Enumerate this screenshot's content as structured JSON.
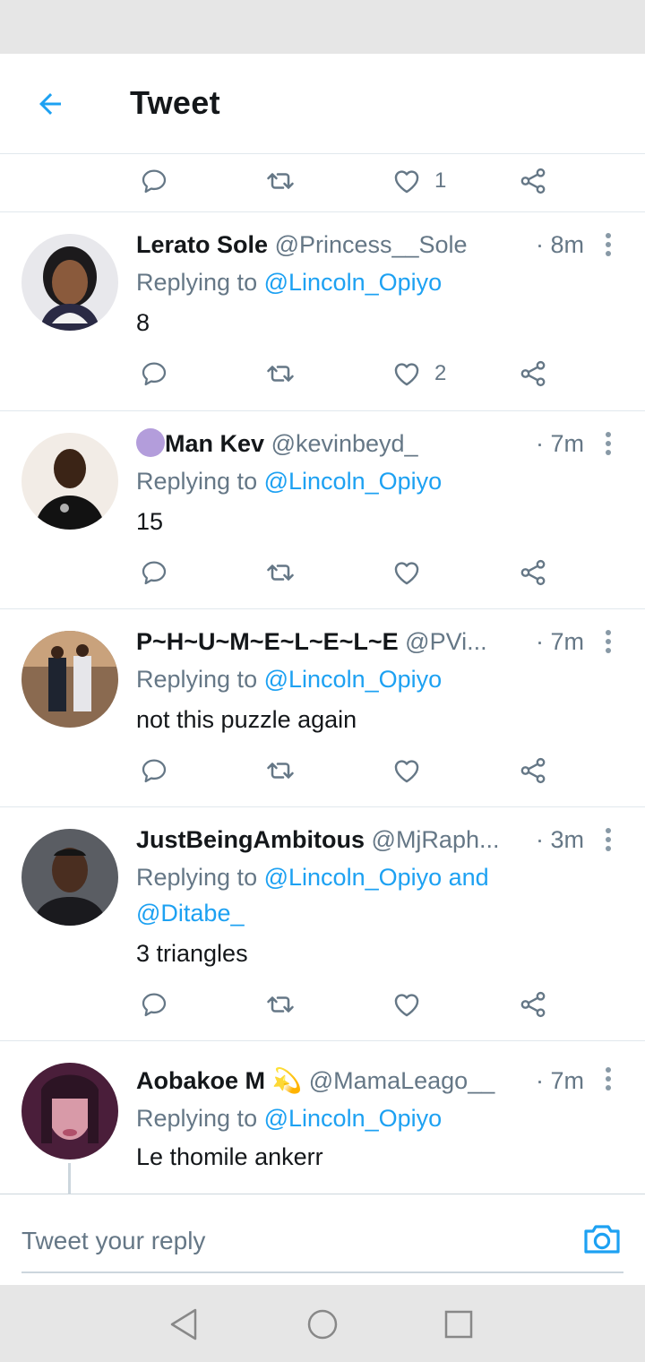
{
  "appbar": {
    "title": "Tweet"
  },
  "top_actions": {
    "like_count": "1"
  },
  "tweets": [
    {
      "name": "Lerato Sole",
      "badge": "",
      "handle": "@Princess__Sole",
      "time": "· 8m",
      "replying_prefix": "Replying to",
      "replying_to": "@Lincoln_Opiyo",
      "text": "8",
      "like_count": "2"
    },
    {
      "name": "Man Kev",
      "badge": "",
      "handle": "@kevinbeyd_",
      "time": "· 7m",
      "replying_prefix": "Replying to",
      "replying_to": "@Lincoln_Opiyo",
      "text": "15",
      "like_count": ""
    },
    {
      "name": "P~H~U~M~E~L~E~L~E",
      "badge": "",
      "handle": "@PVi...",
      "time": "· 7m",
      "replying_prefix": "Replying to",
      "replying_to": "@Lincoln_Opiyo",
      "text": "not this puzzle again",
      "like_count": ""
    },
    {
      "name": "JustBeingAmbitous",
      "badge": "",
      "handle": "@MjRaph...",
      "time": "· 3m",
      "replying_prefix": "Replying to",
      "replying_to": "@Lincoln_Opiyo and",
      "replying_to_2": "@Ditabe_",
      "text": "3 triangles",
      "like_count": ""
    },
    {
      "name": "Aobakoe M",
      "badge": "💫",
      "handle": "@MamaLeago__",
      "time": "· 7m",
      "replying_prefix": "Replying to",
      "replying_to": "@Lincoln_Opiyo",
      "text": "Le thomile ankerr",
      "like_count": ""
    }
  ],
  "reply": {
    "placeholder": "Tweet your reply"
  },
  "colors": {
    "accent": "#1da1f2",
    "secondary_text": "#657786",
    "border": "#e1e8ed",
    "purple_badge": "#b39ddb"
  },
  "icons": [
    "back-arrow-icon",
    "reply-icon",
    "retweet-icon",
    "like-icon",
    "share-icon",
    "more-icon",
    "camera-icon",
    "nav-back-icon",
    "nav-home-icon",
    "nav-recents-icon"
  ]
}
